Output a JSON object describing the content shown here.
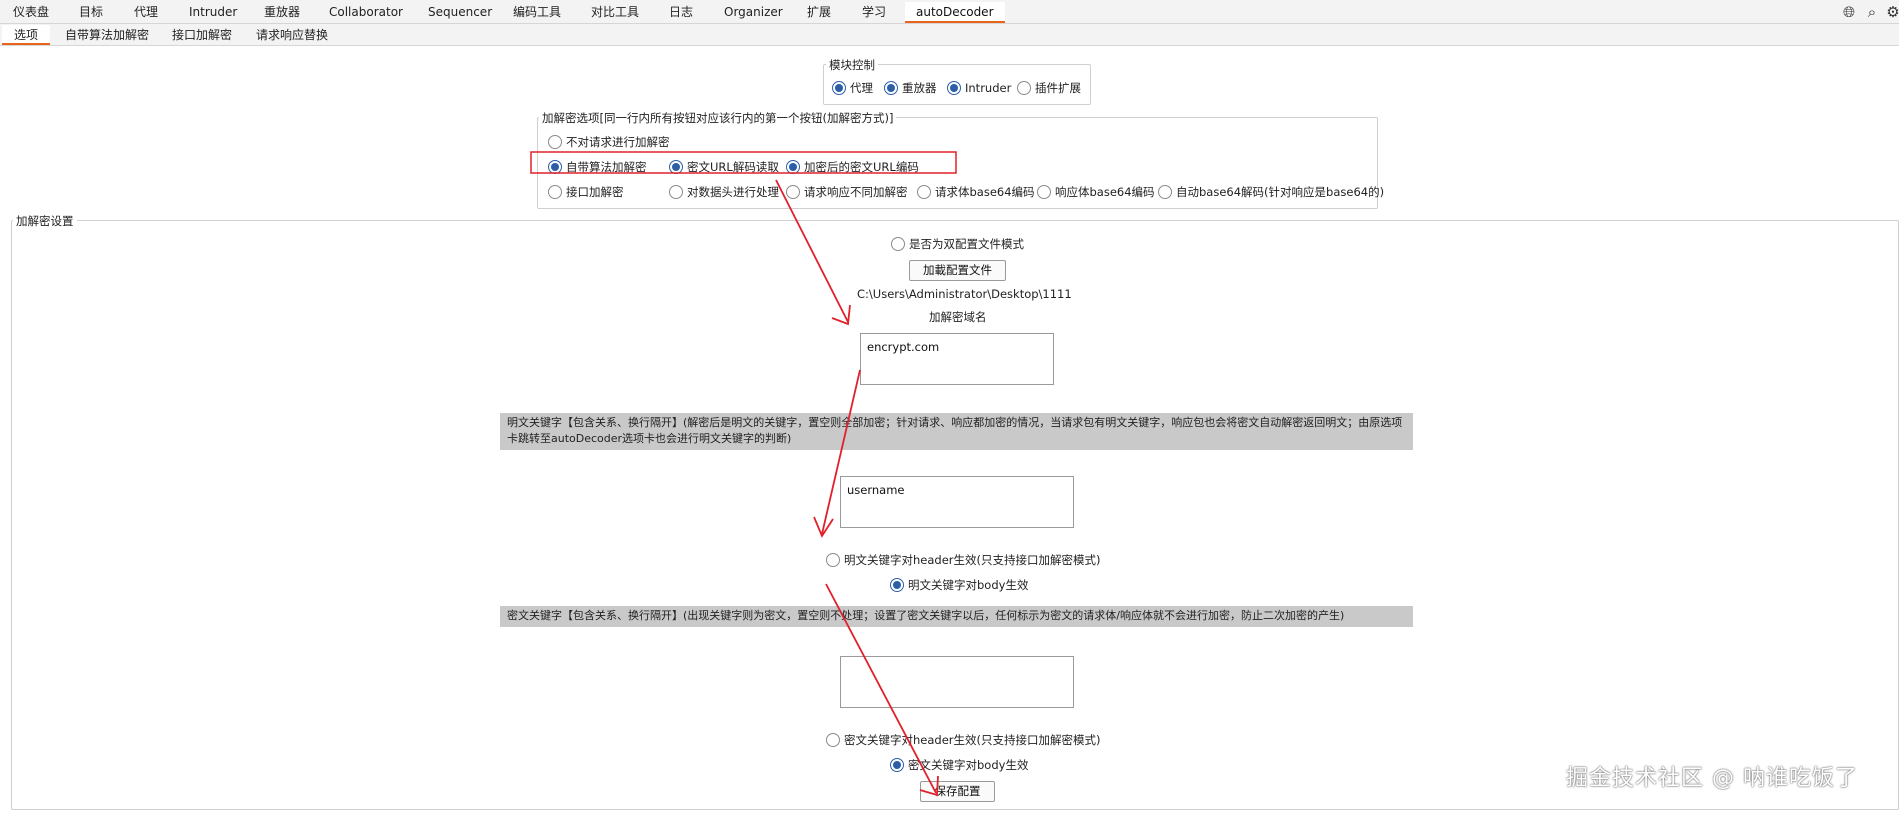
{
  "main_tabs": [
    "仪表盘",
    "目标",
    "代理",
    "Intruder",
    "重放器",
    "Collaborator",
    "Sequencer",
    "编码工具",
    "对比工具",
    "日志",
    "Organizer",
    "扩展",
    "学习",
    "autoDecoder"
  ],
  "active_main_tab": "autoDecoder",
  "sub_tabs": [
    "选项",
    "自带算法加解密",
    "接口加解密",
    "请求响应替换"
  ],
  "active_sub_tab": "选项",
  "module_control": {
    "legend": "模块控制",
    "options": [
      {
        "label": "代理",
        "checked": true
      },
      {
        "label": "重放器",
        "checked": true
      },
      {
        "label": "Intruder",
        "checked": true
      },
      {
        "label": "插件扩展",
        "checked": false
      }
    ]
  },
  "crypto_options": {
    "legend": "加解密选项[同一行内所有按钮对应该行内的第一个按钮(加解密方式)]",
    "row1": [
      {
        "label": "不对请求进行加解密",
        "checked": false
      }
    ],
    "row2": [
      {
        "label": "自带算法加解密",
        "checked": true
      },
      {
        "label": "密文URL解码读取",
        "checked": true
      },
      {
        "label": "加密后的密文URL编码",
        "checked": true
      }
    ],
    "row3": [
      {
        "label": "接口加解密",
        "checked": false
      },
      {
        "label": "对数据头进行处理",
        "checked": false
      },
      {
        "label": "请求响应不同加解密",
        "checked": false
      },
      {
        "label": "请求体base64编码",
        "checked": false
      },
      {
        "label": "响应体base64编码",
        "checked": false
      },
      {
        "label": "自动base64解码(针对响应是base64的)",
        "checked": false
      }
    ]
  },
  "settings": {
    "legend": "加解密设置",
    "dual_config": {
      "label": "是否为双配置文件模式",
      "checked": false
    },
    "load_button": "加載配置文件",
    "config_path": "C:\\Users\\Administrator\\Desktop\\1111",
    "domain_label": "加解密域名",
    "domain_value": "encrypt.com",
    "plaintext_banner": "明文关键字【包含关系、换行隔开】(解密后是明文的关键字，置空则全部加密；针对请求、响应都加密的情况，当请求包有明文关键字，响应包也会将密文自动解密返回明文；由原选项卡跳转至autoDecoder选项卡也会进行明文关键字的判断)",
    "plaintext_value": "username",
    "plain_header": {
      "label": "明文关键字对header生效(只支持接口加解密模式)",
      "checked": false
    },
    "plain_body": {
      "label": "明文关键字对body生效",
      "checked": true
    },
    "cipher_banner": "密文关键字【包含关系、换行隔开】(出现关键字则为密文，置空则不处理；设置了密文关键字以后，任何标示为密文的请求体/响应体就不会进行加密，防止二次加密的产生)",
    "cipher_value": "",
    "cipher_header": {
      "label": "密文关键字对header生效(只支持接口加解密模式)",
      "checked": false
    },
    "cipher_body": {
      "label": "密文关键字对body生效",
      "checked": true
    },
    "save_button": "保存配置"
  },
  "watermark": "掘金技术社区 @ 呐谁吃饭了",
  "icons": [
    "globe-icon",
    "search-icon",
    "settings-icon"
  ],
  "colors": {
    "accent": "#e8641b",
    "radio": "#2c5fa8",
    "annotation": "#e0202a",
    "banner": "#c9c9c9"
  }
}
